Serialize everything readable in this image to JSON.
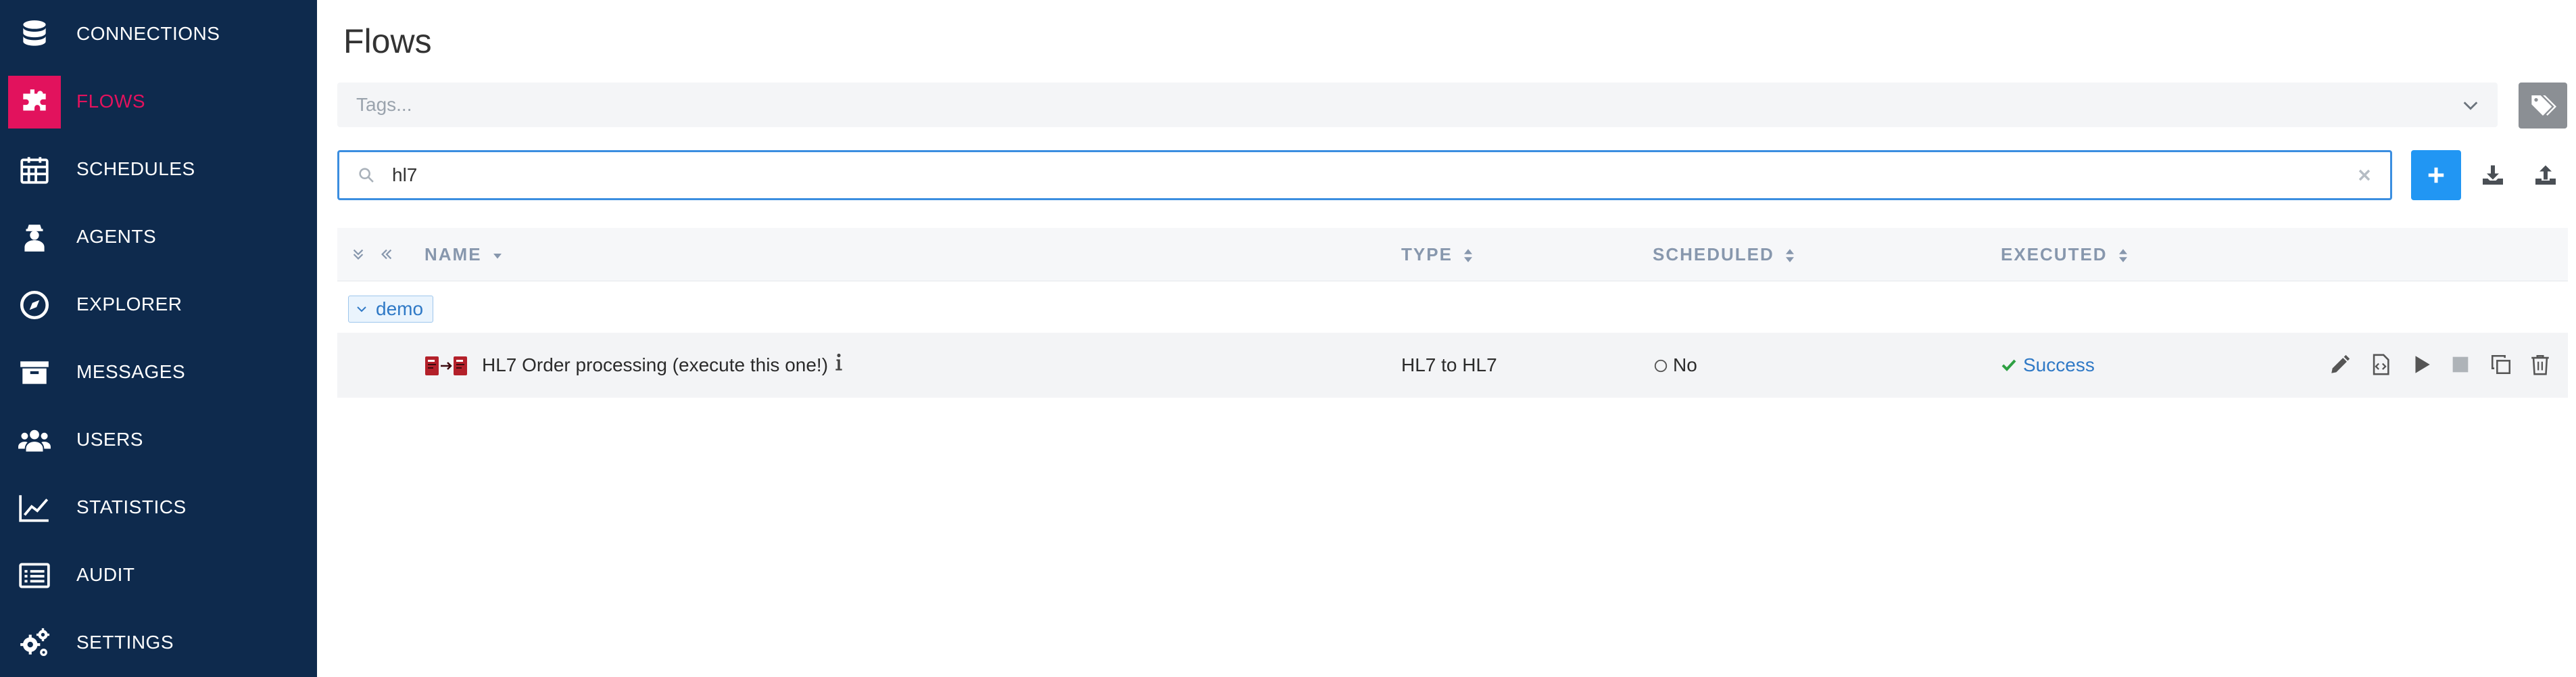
{
  "sidebar": {
    "items": [
      {
        "label": "CONNECTIONS",
        "icon": "database-icon",
        "active": false
      },
      {
        "label": "FLOWS",
        "icon": "puzzle-icon",
        "active": true
      },
      {
        "label": "SCHEDULES",
        "icon": "calendar-icon",
        "active": false
      },
      {
        "label": "AGENTS",
        "icon": "agent-icon",
        "active": false
      },
      {
        "label": "EXPLORER",
        "icon": "compass-icon",
        "active": false
      },
      {
        "label": "MESSAGES",
        "icon": "archive-icon",
        "active": false
      },
      {
        "label": "USERS",
        "icon": "users-icon",
        "active": false
      },
      {
        "label": "STATISTICS",
        "icon": "line-chart-icon",
        "active": false
      },
      {
        "label": "AUDIT",
        "icon": "list-icon",
        "active": false
      },
      {
        "label": "SETTINGS",
        "icon": "gears-icon",
        "active": false
      }
    ]
  },
  "main": {
    "title": "Flows",
    "tags": {
      "placeholder": "Tags..."
    },
    "search": {
      "value": "hl7"
    },
    "table": {
      "columns": [
        "NAME",
        "TYPE",
        "SCHEDULED",
        "EXECUTED"
      ],
      "groups": [
        {
          "name": "demo",
          "rows": [
            {
              "name": "HL7 Order processing (execute this one!)",
              "type": "HL7 to HL7",
              "scheduled": "No",
              "executed": "Success"
            }
          ]
        }
      ]
    }
  },
  "colors": {
    "sidebar_bg": "#0e2a4d",
    "accent": "#e2125d",
    "primary": "#2196f3",
    "success": "#2ea043",
    "link": "#2f79c6"
  }
}
